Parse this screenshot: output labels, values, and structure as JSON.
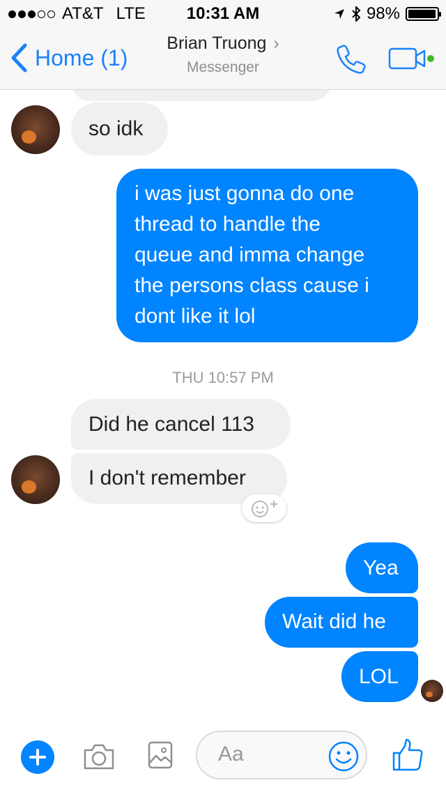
{
  "status": {
    "carrier": "AT&T",
    "network": "LTE",
    "time": "10:31 AM",
    "battery": "98%",
    "battery_level": 0.98
  },
  "nav": {
    "back_label": "Home (1)",
    "contact_name": "Brian Truong",
    "subtitle": "Messenger"
  },
  "thread": {
    "msg_so_idk": "so idk",
    "out_long_lines": [
      "i was just gonna do one",
      "thread to handle the",
      "queue and imma change",
      "the persons class cause i",
      "dont like it lol"
    ],
    "timestamp": "THU 10:57 PM",
    "msg_cancel": "Did he cancel 113",
    "msg_remember": "I don't remember",
    "msg_yea": "Yea",
    "msg_wait": "Wait did he",
    "msg_lol": "LOL"
  },
  "composer": {
    "placeholder": "Aa"
  },
  "colors": {
    "accent": "#0084ff",
    "link": "#1a82fb",
    "incoming_bubble": "#f1f0f0",
    "online": "#42b72a"
  },
  "icons": [
    "back-chevron-icon",
    "phone-icon",
    "video-camera-icon",
    "plus-icon",
    "camera-icon",
    "image-icon",
    "emoji-icon",
    "thumbs-up-icon",
    "add-reaction-icon"
  ]
}
